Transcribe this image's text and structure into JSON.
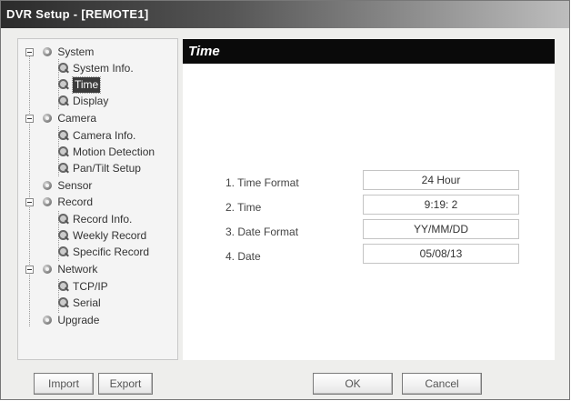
{
  "window": {
    "title": "DVR Setup - [REMOTE1]"
  },
  "tree": {
    "items": [
      {
        "label": "System",
        "level": 0,
        "icon": "folder-icon",
        "expanded": true
      },
      {
        "label": "System Info.",
        "level": 1,
        "icon": "magnifier-icon"
      },
      {
        "label": "Time",
        "level": 1,
        "icon": "magnifier-icon",
        "selected": true
      },
      {
        "label": "Display",
        "level": 1,
        "icon": "magnifier-icon"
      },
      {
        "label": "Camera",
        "level": 0,
        "icon": "folder-icon",
        "expanded": true
      },
      {
        "label": "Camera Info.",
        "level": 1,
        "icon": "magnifier-icon"
      },
      {
        "label": "Motion Detection",
        "level": 1,
        "icon": "magnifier-icon"
      },
      {
        "label": "Pan/Tilt Setup",
        "level": 1,
        "icon": "magnifier-icon"
      },
      {
        "label": "Sensor",
        "level": 0,
        "icon": "folder-icon"
      },
      {
        "label": "Record",
        "level": 0,
        "icon": "folder-icon",
        "expanded": true
      },
      {
        "label": "Record Info.",
        "level": 1,
        "icon": "magnifier-icon"
      },
      {
        "label": "Weekly Record",
        "level": 1,
        "icon": "magnifier-icon"
      },
      {
        "label": "Specific Record",
        "level": 1,
        "icon": "magnifier-icon"
      },
      {
        "label": "Network",
        "level": 0,
        "icon": "folder-icon",
        "expanded": true
      },
      {
        "label": "TCP/IP",
        "level": 1,
        "icon": "magnifier-icon"
      },
      {
        "label": "Serial",
        "level": 1,
        "icon": "magnifier-icon"
      },
      {
        "label": "Upgrade",
        "level": 0,
        "icon": "folder-icon"
      }
    ]
  },
  "panel": {
    "title": "Time"
  },
  "fields": [
    {
      "label": "1. Time Format",
      "value": "24 Hour"
    },
    {
      "label": "2. Time",
      "value": "9:19: 2"
    },
    {
      "label": "3. Date Format",
      "value": "YY/MM/DD"
    },
    {
      "label": "4. Date",
      "value": "05/08/13"
    }
  ],
  "buttons": {
    "import": "Import",
    "export": "Export",
    "ok": "OK",
    "cancel": "Cancel"
  },
  "colors": {
    "header_bg": "#0a0a0a",
    "selected_bg": "#3b3b3b"
  }
}
